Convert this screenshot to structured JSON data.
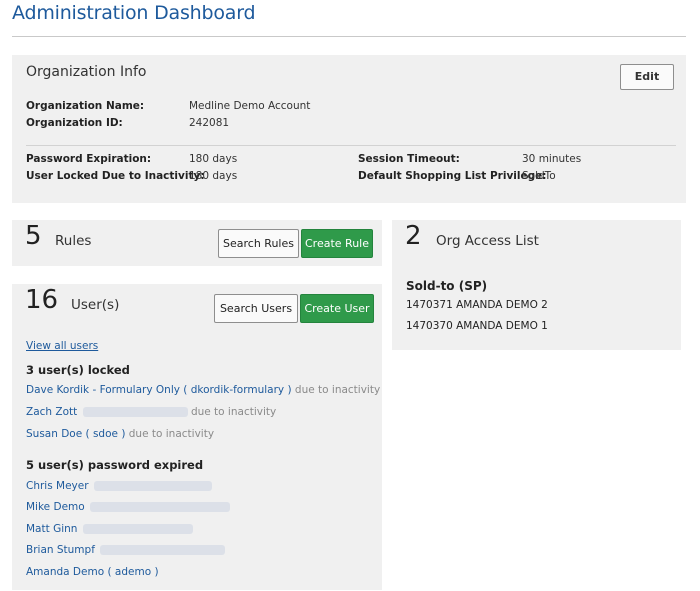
{
  "page": {
    "title": "Administration Dashboard"
  },
  "org_info": {
    "heading": "Organization Info",
    "edit_label": "Edit",
    "fields": {
      "org_name_label": "Organization Name:",
      "org_name_value": "Medline Demo Account",
      "org_id_label": "Organization ID:",
      "org_id_value": "242081",
      "pw_exp_label": "Password Expiration:",
      "pw_exp_value": "180 days",
      "locked_label": "User Locked Due to Inactivity:",
      "locked_value": "180 days",
      "session_label": "Session Timeout:",
      "session_value": "30 minutes",
      "shopping_label": "Default Shopping List Privilege:",
      "shopping_value": "SoldTo"
    }
  },
  "rules": {
    "count": "5",
    "label": "Rules",
    "search_label": "Search Rules",
    "create_label": "Create Rule"
  },
  "users": {
    "count": "16",
    "label": "User(s)",
    "search_label": "Search Users",
    "create_label": "Create User",
    "view_all": "View all users",
    "locked_heading": "3 user(s) locked",
    "locked": [
      {
        "name": "Dave  Kordik - Formulary Only ( dkordik-formulary )",
        "note": "due to inactivity"
      },
      {
        "name": "Zach  Zott",
        "note": "due to inactivity"
      },
      {
        "name": "Susan  Doe ( sdoe )",
        "note": "due to inactivity"
      }
    ],
    "expired_heading": "5 user(s) password expired",
    "expired": [
      {
        "name": "Chris  Meyer"
      },
      {
        "name": "Mike  Demo"
      },
      {
        "name": "Matt  Ginn"
      },
      {
        "name": "Brian  Stumpf"
      },
      {
        "name": "Amanda  Demo ( ademo )"
      }
    ]
  },
  "org_access": {
    "count": "2",
    "label": "Org Access List",
    "heading": "Sold-to (SP)",
    "entries": [
      "1470371  AMANDA DEMO 2",
      "1470370  AMANDA DEMO 1"
    ]
  },
  "colors": {
    "link": "#1e5a9c",
    "button_green": "#2f9a4a",
    "panel_bg": "#f0f0f0"
  }
}
